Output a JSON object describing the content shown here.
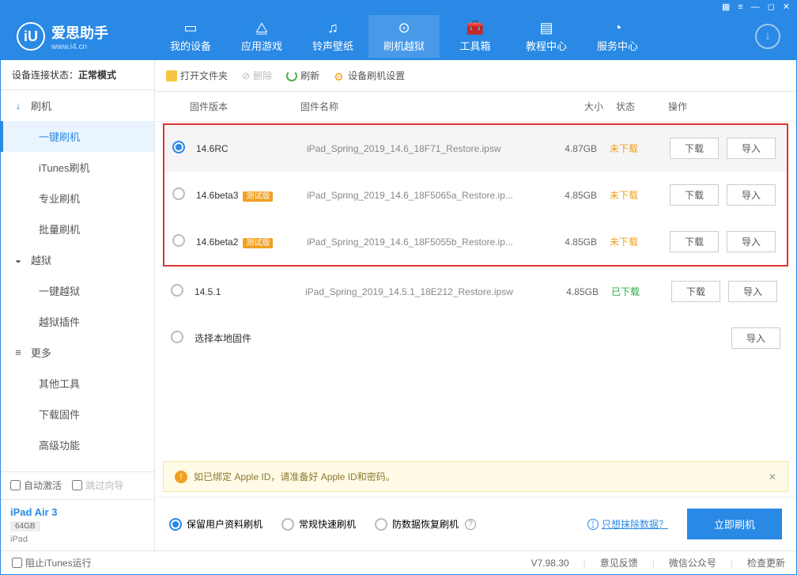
{
  "titlebar": {
    "icons": [
      "▦",
      "≡",
      "—",
      "◻",
      "✕"
    ]
  },
  "header": {
    "brand": "爱思助手",
    "brand_sub": "www.i4.cn",
    "nav": [
      "我的设备",
      "应用游戏",
      "铃声壁纸",
      "刷机越狱",
      "工具箱",
      "教程中心",
      "服务中心"
    ],
    "nav_icons": [
      "▭",
      "⧋",
      "♫",
      "⊙",
      "🧰",
      "▤",
      "◔"
    ]
  },
  "sidebar": {
    "conn_label": "设备连接状态：",
    "conn_value": "正常模式",
    "groups": [
      {
        "icon": "↓",
        "label": "刷机",
        "color": "#2989e5",
        "items": [
          "一键刷机",
          "iTunes刷机",
          "专业刷机",
          "批量刷机"
        ],
        "activeIndex": 0
      },
      {
        "icon": "◒",
        "label": "越狱",
        "color": "#888",
        "items": [
          "一键越狱",
          "越狱插件"
        ]
      },
      {
        "icon": "≡",
        "label": "更多",
        "color": "#888",
        "items": [
          "其他工具",
          "下载固件",
          "高级功能"
        ]
      }
    ],
    "auto_activate": "自动激活",
    "skip_guide": "跳过向导",
    "device_name": "iPad Air 3",
    "device_storage": "64GB",
    "device_type": "iPad"
  },
  "toolbar": {
    "open_folder": "打开文件夹",
    "delete": "删除",
    "refresh": "刷新",
    "settings": "设备刷机设置"
  },
  "columns": {
    "ver": "固件版本",
    "name": "固件名称",
    "size": "大小",
    "status": "状态",
    "ops": "操作"
  },
  "rows": [
    {
      "selected": true,
      "ver": "14.6RC",
      "test": false,
      "name": "iPad_Spring_2019_14.6_18F71_Restore.ipsw",
      "size": "4.87GB",
      "status": "未下载",
      "downloaded": false
    },
    {
      "selected": false,
      "ver": "14.6beta3",
      "test": true,
      "name": "iPad_Spring_2019_14.6_18F5065a_Restore.ip...",
      "size": "4.85GB",
      "status": "未下载",
      "downloaded": false
    },
    {
      "selected": false,
      "ver": "14.6beta2",
      "test": true,
      "name": "iPad_Spring_2019_14.6_18F5055b_Restore.ip...",
      "size": "4.85GB",
      "status": "未下载",
      "downloaded": false
    },
    {
      "selected": false,
      "ver": "14.5.1",
      "test": false,
      "name": "iPad_Spring_2019_14.5.1_18E212_Restore.ipsw",
      "size": "4.85GB",
      "status": "已下载",
      "downloaded": true
    }
  ],
  "local_fw": "选择本地固件",
  "test_badge": "测试版",
  "btns": {
    "download": "下载",
    "import": "导入"
  },
  "notice": "如已绑定 Apple ID，请准备好 Apple ID和密码。",
  "modes": {
    "keep": "保留用户资料刷机",
    "normal": "常规快速刷机",
    "recover": "防数据恢复刷机"
  },
  "erase_link": "只想抹除数据？",
  "flash_btn": "立即刷机",
  "footer": {
    "block_itunes": "阻止iTunes运行",
    "version": "V7.98.30",
    "feedback": "意见反馈",
    "wechat": "微信公众号",
    "update": "检查更新"
  }
}
